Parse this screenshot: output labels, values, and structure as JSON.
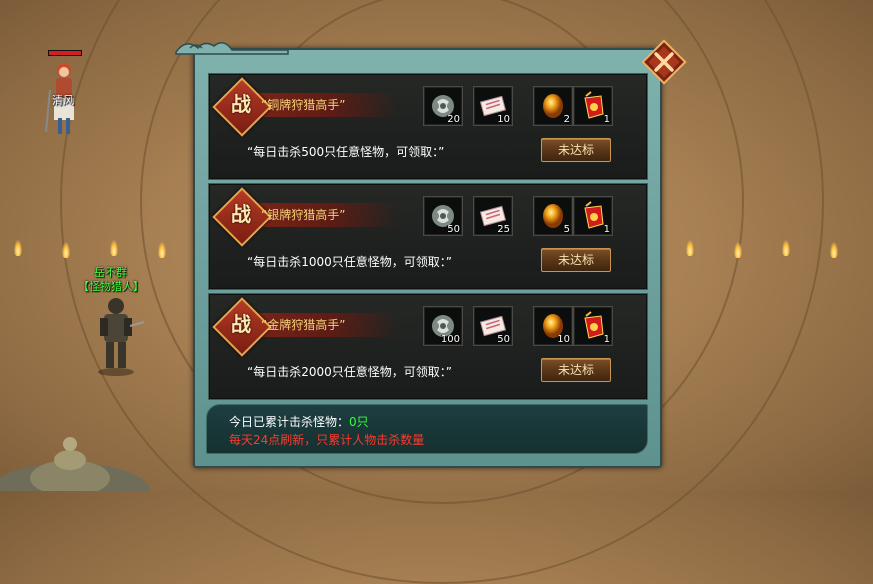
{
  "scene": {
    "player_name": "清风",
    "npc_name": "岳不群",
    "npc_title": "【怪物猎人】"
  },
  "panel": {
    "close_label": "",
    "tasks": [
      {
        "badge": "战",
        "title": "“铜牌狩猎高手”",
        "description": "“每日击杀500只任意怪物，可领取：”",
        "status_label": "未达标",
        "rewards": [
          {
            "icon": "jade-token-icon",
            "count": "20"
          },
          {
            "icon": "scroll-note-icon",
            "count": "10"
          },
          {
            "icon": "gold-orb-icon",
            "count": "2"
          },
          {
            "icon": "red-pouch-icon",
            "count": "1"
          }
        ]
      },
      {
        "badge": "战",
        "title": "“银牌狩猎高手”",
        "description": "“每日击杀1000只任意怪物，可领取：”",
        "status_label": "未达标",
        "rewards": [
          {
            "icon": "jade-token-icon",
            "count": "50"
          },
          {
            "icon": "scroll-note-icon",
            "count": "25"
          },
          {
            "icon": "gold-orb-icon",
            "count": "5"
          },
          {
            "icon": "red-pouch-icon",
            "count": "1"
          }
        ]
      },
      {
        "badge": "战",
        "title": "“金牌狩猎高手”",
        "description": "“每日击杀2000只任意怪物，可领取：”",
        "status_label": "未达标",
        "rewards": [
          {
            "icon": "jade-token-icon",
            "count": "100"
          },
          {
            "icon": "scroll-note-icon",
            "count": "50"
          },
          {
            "icon": "gold-orb-icon",
            "count": "10"
          },
          {
            "icon": "red-pouch-icon",
            "count": "1"
          }
        ]
      }
    ],
    "footer": {
      "kill_prefix": "今日已累计击杀怪物：",
      "kill_count": "0只",
      "notice": "每天24点刷新，只累计人物击杀数量"
    }
  }
}
